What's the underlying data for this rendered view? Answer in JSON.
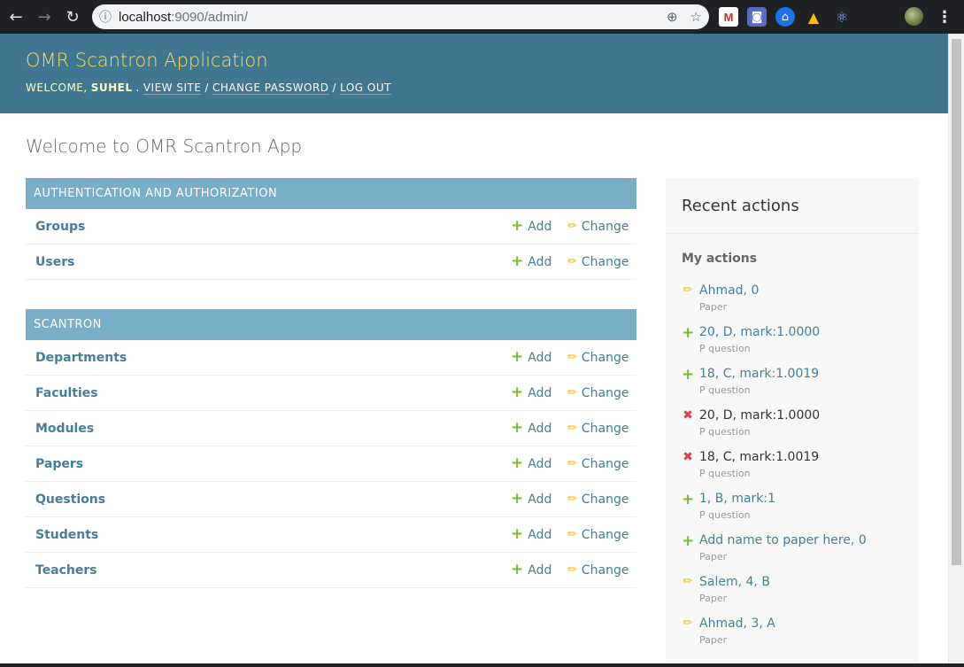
{
  "browser": {
    "url_host": "localhost",
    "url_path": ":9090/admin/",
    "extensions": [
      {
        "name": "gmail-icon",
        "glyph": "M"
      },
      {
        "name": "camera-icon",
        "glyph": "◙"
      },
      {
        "name": "bank-icon",
        "glyph": "⌂"
      },
      {
        "name": "drive-icon",
        "glyph": "▲"
      },
      {
        "name": "react-icon",
        "glyph": "⚛"
      }
    ]
  },
  "header": {
    "branding": "OMR Scantron Application",
    "welcome": "Welcome,",
    "username": "suhel",
    "view_site": "View site",
    "change_password": "Change password",
    "log_out": "Log out"
  },
  "page_title": "Welcome to OMR Scantron App",
  "modules": [
    {
      "caption": "Authentication and Authorization",
      "models": [
        "Groups",
        "Users"
      ]
    },
    {
      "caption": "Scantron",
      "models": [
        "Departments",
        "Faculties",
        "Modules",
        "Papers",
        "Questions",
        "Students",
        "Teachers"
      ]
    }
  ],
  "links": {
    "add": "Add",
    "change": "Change"
  },
  "recent_actions": {
    "title": "Recent actions",
    "my_actions": "My actions",
    "items": [
      {
        "kind": "change",
        "text": "Ahmad, 0",
        "type": "Paper"
      },
      {
        "kind": "add",
        "text": "20, D, mark:1.0000",
        "type": "P question"
      },
      {
        "kind": "add",
        "text": "18, C, mark:1.0019",
        "type": "P question"
      },
      {
        "kind": "delete",
        "text": "20, D, mark:1.0000",
        "type": "P question"
      },
      {
        "kind": "delete",
        "text": "18, C, mark:1.0019",
        "type": "P question"
      },
      {
        "kind": "add",
        "text": "1, B, mark:1",
        "type": "P question"
      },
      {
        "kind": "add",
        "text": "Add name to paper here, 0",
        "type": "Paper"
      },
      {
        "kind": "change",
        "text": "Salem, 4, B",
        "type": "Paper"
      },
      {
        "kind": "change",
        "text": "Ahmad, 3, A",
        "type": "Paper"
      }
    ]
  },
  "colors": {
    "header_bg": "#417690",
    "branding": "#f5dd5d",
    "module_caption_bg": "#79aec8",
    "link": "#447e9b",
    "add_icon": "#70bf2b",
    "change_icon": "#efb80b",
    "delete_icon": "#dd4646"
  }
}
